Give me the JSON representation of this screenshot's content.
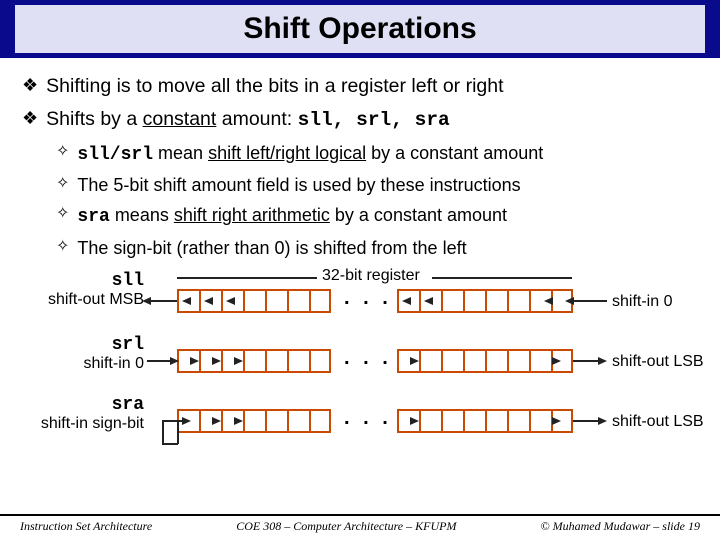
{
  "title": "Shift Operations",
  "bullets": {
    "b1": "Shifting is to move all the bits in a register left or right",
    "b2_prefix": "Shifts by a ",
    "b2_const": "constant",
    "b2_mid": " amount: ",
    "b2_mono": "sll, srl, sra",
    "s1_mono": "sll/srl",
    "s1_mid": " mean ",
    "s1_u": "shift left/right logical",
    "s1_end": " by a constant amount",
    "s2": "The 5-bit shift amount field is used by these instructions",
    "s3_mono": "sra",
    "s3_mid": " means ",
    "s3_u": "shift right arithmetic",
    "s3_end": " by a constant amount",
    "s4": "The sign-bit (rather than 0) is shifted from the left"
  },
  "diagram": {
    "reg_label": "32-bit register",
    "sll": "sll",
    "sll_sub": "shift-out MSB",
    "sll_right": "shift-in 0",
    "srl": "srl",
    "srl_sub": "shift-in 0",
    "srl_right": "shift-out LSB",
    "sra": "sra",
    "sra_sub": "shift-in sign-bit",
    "sra_right": "shift-out LSB",
    "dots": ". . ."
  },
  "footer": {
    "left": "Instruction Set Architecture",
    "center": "COE 308 – Computer Architecture – KFUPM",
    "right": "© Muhamed Mudawar – slide 19"
  }
}
